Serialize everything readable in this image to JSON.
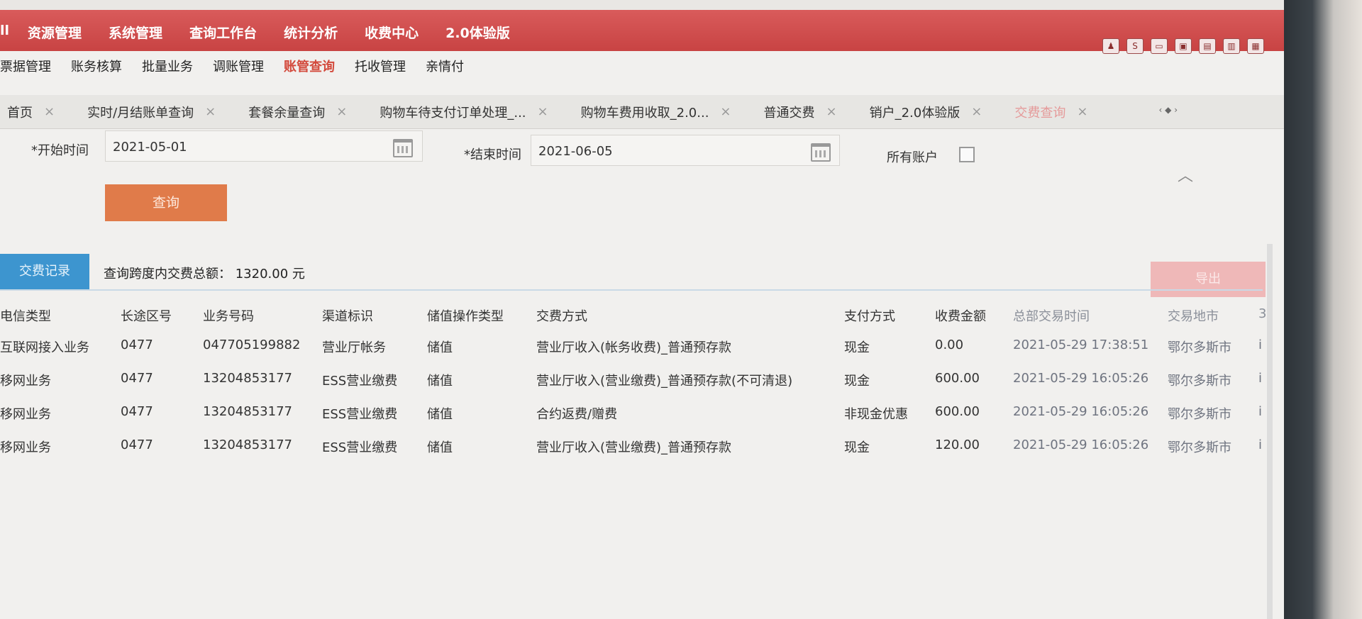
{
  "top_menu": [
    "ll",
    "资源管理",
    "系统管理",
    "查询工作台",
    "统计分析",
    "收费中心",
    "2.0体验版"
  ],
  "tool_icons": [
    "user-icon",
    "s-icon",
    "window-icon",
    "window-icon",
    "window-icon",
    "window-icon",
    "window-icon"
  ],
  "sub_menu": {
    "items": [
      "票据管理",
      "账务核算",
      "批量业务",
      "调账管理",
      "账管查询",
      "托收管理",
      "亲情付"
    ],
    "active": "账管查询"
  },
  "tabs": [
    {
      "label": "首页",
      "current": false
    },
    {
      "label": "实时/月结账单查询",
      "current": false
    },
    {
      "label": "套餐余量查询",
      "current": false
    },
    {
      "label": "购物车待支付订单处理_...",
      "current": false
    },
    {
      "label": "购物车费用收取_2.0...",
      "current": false
    },
    {
      "label": "普通交费",
      "current": false
    },
    {
      "label": "销户_2.0体验版",
      "current": false
    },
    {
      "label": "交费查询",
      "current": true
    }
  ],
  "tab_arrows": "‹ ◆ ›",
  "tab_close": "×",
  "form": {
    "start_label": "*开始时间",
    "start_value": "2021-05-01",
    "end_label": "*结束时间",
    "end_value": "2021-06-05",
    "all_accounts_label": "所有账户",
    "all_accounts_checked": false,
    "query_button": "查询"
  },
  "records": {
    "tab_label": "交费记录",
    "summary": "查询跨度内交费总额： 1320.00 元",
    "export_button": "导出"
  },
  "table": {
    "columns": [
      "电信类型",
      "长途区号",
      "业务号码",
      "渠道标识",
      "储值操作类型",
      "交费方式",
      "支付方式",
      "收费金额",
      "总部交易时间",
      "交易地市",
      "3"
    ],
    "rows": [
      [
        "互联网接入业务",
        "0477",
        "047705199882",
        "营业厅帐务",
        "储值",
        "营业厅收入(帐务收费)_普通预存款",
        "现金",
        "0.00",
        "2021-05-29 17:38:51",
        "鄂尔多斯市",
        "i"
      ],
      [
        "移网业务",
        "0477",
        "13204853177",
        "ESS营业缴费",
        "储值",
        "营业厅收入(营业缴费)_普通预存款(不可清退)",
        "现金",
        "600.00",
        "2021-05-29 16:05:26",
        "鄂尔多斯市",
        "i"
      ],
      [
        "移网业务",
        "0477",
        "13204853177",
        "ESS营业缴费",
        "储值",
        "合约返费/赠费",
        "非现金优惠",
        "600.00",
        "2021-05-29 16:05:26",
        "鄂尔多斯市",
        "i"
      ],
      [
        "移网业务",
        "0477",
        "13204853177",
        "ESS营业缴费",
        "储值",
        "营业厅收入(营业缴费)_普通预存款",
        "现金",
        "120.00",
        "2021-05-29 16:05:26",
        "鄂尔多斯市",
        "i"
      ]
    ]
  },
  "colors": {
    "topbar": "#c84343",
    "active_menu": "#d34a3c",
    "query_button": "#e07b4a",
    "records_tab": "#3d95cf",
    "export_button": "#efb8b8"
  }
}
